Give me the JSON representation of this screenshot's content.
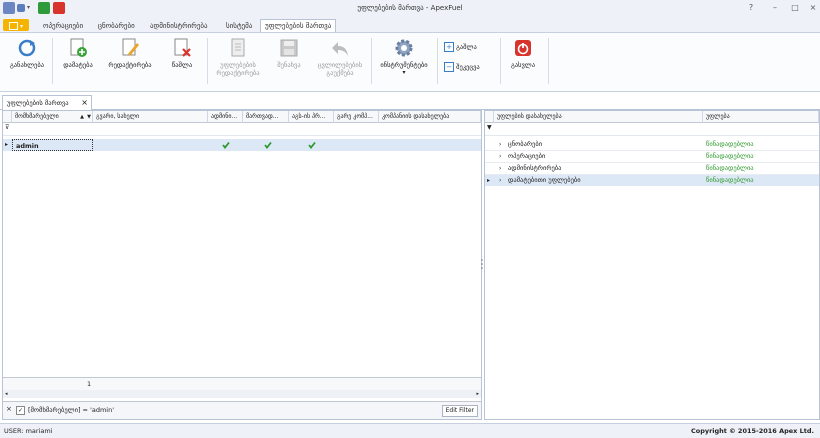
{
  "window": {
    "title": "უფლებების მართვა - ApexFuel"
  },
  "ribbon_tabs": [
    {
      "label": "ოპერაციები"
    },
    {
      "label": "ცნობარები"
    },
    {
      "label": "ადმინისტრირება"
    },
    {
      "label": "სისტემა"
    },
    {
      "label": "უფლებების მართვა",
      "active": true
    }
  ],
  "ribbon": {
    "refresh": "განახლება",
    "add": "დამატება",
    "edit": "რედაქტირება",
    "delete": "წაშლა",
    "edit_rights_line1": "უფლებების",
    "edit_rights_line2": "რედაქტირება",
    "save": "შენახვა",
    "cancel_line1": "ცვლილებების",
    "cancel_line2": "გაუქმება",
    "tools": "ინსტრუმენტები",
    "expand": "გაშლა",
    "collapse": "შეკეცვა",
    "exit": "გასვლა"
  },
  "doc_tab": {
    "label": "უფლებების მართვა"
  },
  "users_grid": {
    "columns": [
      "მომხმარებელი",
      "გვარი, სახელი",
      "ადმინი...",
      "მართვად...",
      "აგს-ის პრ...",
      "გარე კომპ...",
      "კომპანიის დასახელება"
    ],
    "rows": [
      {
        "user": "admin",
        "full_name": "",
        "admin": true,
        "managed": true,
        "ags": true,
        "external": false,
        "company": ""
      }
    ],
    "footer_count": "1",
    "filter_text": "[მომხმარებელი] = 'admin'",
    "edit_filter": "Edit Filter"
  },
  "rights_grid": {
    "columns": [
      "უფლების დასახელება",
      "უფლება"
    ],
    "rows": [
      {
        "name": "ცნობარები",
        "value": "წინადადებლია"
      },
      {
        "name": "ოპერაციები",
        "value": "წინადადებლია"
      },
      {
        "name": "ადმინისტრირება",
        "value": "წინადადებლია"
      },
      {
        "name": "დამატებითი უფლებები",
        "value": "წინადადებლია"
      }
    ]
  },
  "statusbar": {
    "user": "USER: mariami",
    "copyright": "Copyright © 2015-2016 Apex Ltd."
  },
  "colors": {
    "accent": "#f4b400",
    "green_text": "#2e9a2e",
    "selected_row": "#dde8f6",
    "exit_red": "#d9342b"
  }
}
